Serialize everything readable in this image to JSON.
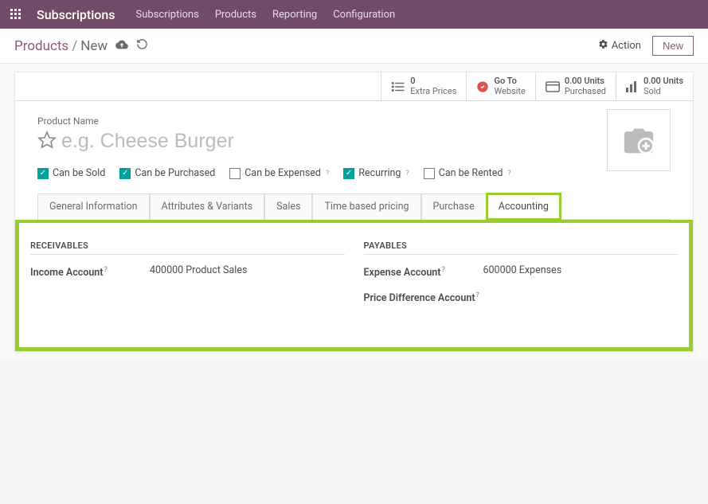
{
  "nav": {
    "brand": "Subscriptions",
    "links": [
      "Subscriptions",
      "Products",
      "Reporting",
      "Configuration"
    ]
  },
  "breadcrumb": {
    "root": "Products",
    "current": "New",
    "action_label": "Action",
    "new_label": "New"
  },
  "stats": {
    "extra_prices": {
      "count": "0",
      "label": "Extra Prices"
    },
    "website": {
      "line1": "Go To",
      "line2": "Website"
    },
    "purchased": {
      "count": "0.00 Units",
      "label": "Purchased"
    },
    "sold": {
      "count": "0.00 Units",
      "label": "Sold"
    }
  },
  "product": {
    "label": "Product Name",
    "placeholder": "e.g. Cheese Burger"
  },
  "checks": {
    "sold": "Can be Sold",
    "purchased": "Can be Purchased",
    "expensed": "Can be Expensed",
    "recurring": "Recurring",
    "rented": "Can be Rented"
  },
  "tabs": {
    "general": "General Information",
    "attrs": "Attributes & Variants",
    "sales": "Sales",
    "time": "Time based pricing",
    "purchase": "Purchase",
    "accounting": "Accounting"
  },
  "accounting": {
    "receivables_head": "RECEIVABLES",
    "payables_head": "PAYABLES",
    "income_label": "Income Account",
    "income_value": "400000 Product Sales",
    "expense_label": "Expense Account",
    "expense_value": "600000 Expenses",
    "pricediff_label": "Price Difference Account"
  }
}
